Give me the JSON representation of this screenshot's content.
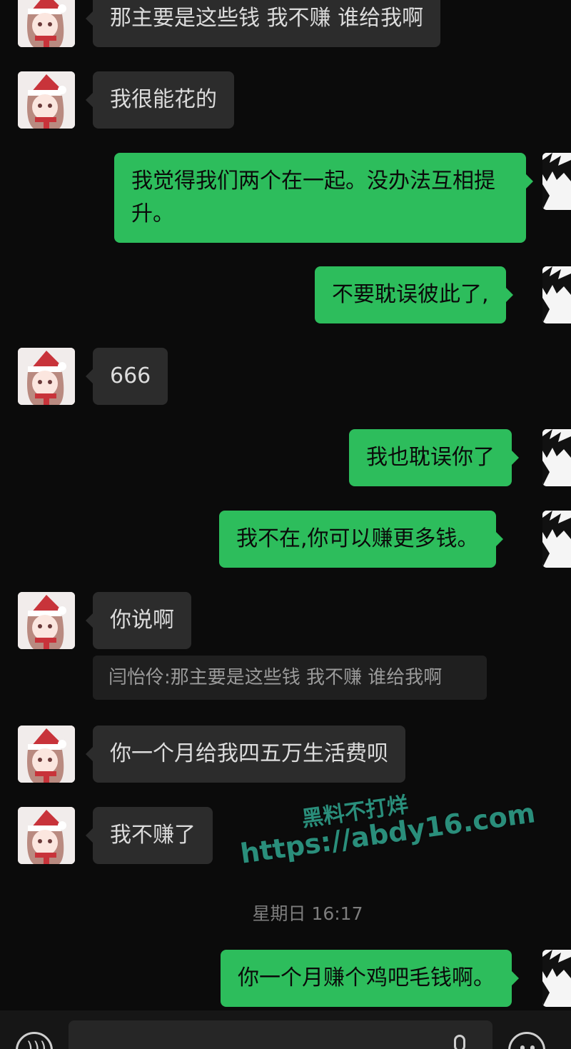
{
  "messages": [
    {
      "side": "in",
      "text": "那主要是这些钱 我不赚 谁给我啊"
    },
    {
      "side": "in",
      "text": "我很能花的"
    },
    {
      "side": "out",
      "text": "我觉得我们两个在一起。没办法互相提升。"
    },
    {
      "side": "out",
      "text": "不要耽误彼此了,"
    },
    {
      "side": "in",
      "text": "666"
    },
    {
      "side": "out",
      "text": "我也耽误你了"
    },
    {
      "side": "out",
      "text": "我不在,你可以赚更多钱。"
    },
    {
      "side": "in",
      "text": "你说啊"
    },
    {
      "side": "in",
      "text": "你一个月给我四五万生活费呗"
    },
    {
      "side": "in",
      "text": "我不赚了"
    },
    {
      "side": "out",
      "text": "你一个月赚个鸡吧毛钱啊。"
    }
  ],
  "quote": {
    "text": "闫怡伶:那主要是这些钱 我不赚 谁给我啊"
  },
  "timestamp": "星期日 16:17",
  "watermark": {
    "line1": "黑料不打烊",
    "line2": "https://abdy16.com"
  },
  "icons": {
    "voice": "voice-icon",
    "mic": "mic-icon",
    "emoji": "emoji-icon"
  },
  "colors": {
    "background": "#0b0b0b",
    "incoming_bubble": "#2c2c2c",
    "outgoing_bubble": "#2dbd5c",
    "watermark": "#2a8e7b"
  }
}
